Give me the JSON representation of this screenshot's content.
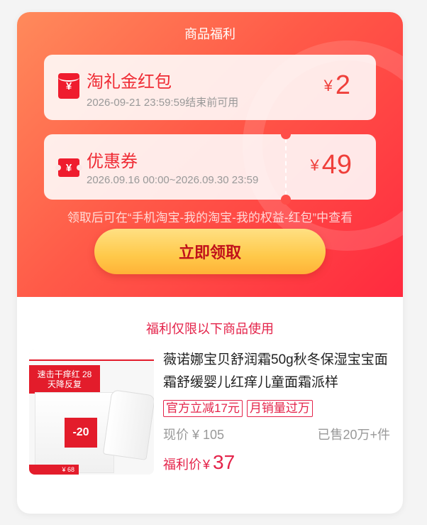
{
  "header": {
    "title": "商品福利"
  },
  "coupons": [
    {
      "name": "淘礼金红包",
      "validity": "2026-09-21 23:59:59结束前可用",
      "currency": "¥",
      "amount": "2",
      "icon": "red-envelope-icon"
    },
    {
      "name": "优惠券",
      "validity": "2026.09.16 00:00~2026.09.30 23:59",
      "currency": "¥",
      "amount": "49",
      "icon": "ticket-icon"
    }
  ],
  "hint": "领取后可在“手机淘宝-我的淘宝-我的权益-红包”中查看",
  "claim_button": "立即领取",
  "product_section": {
    "title": "福利仅限以下商品使用",
    "product": {
      "title": "薇诺娜宝贝舒润霜50g秋冬保湿宝宝面霜舒缓婴儿红痒儿童面霜派样",
      "tags": [
        "官方立减17元",
        "月销量过万"
      ],
      "current_price": "现价 ¥ 105",
      "sold": "已售20万+件",
      "deal_label": "福利价",
      "deal_currency": "¥",
      "deal_price": "37",
      "image_text": {
        "headline": "速击干痒红 28天降反复",
        "badge": "-20",
        "footer": "¥ 68"
      }
    }
  },
  "colors": {
    "accent": "#ef2b34",
    "price_red": "#e4234a",
    "button_gold": "#ffc94a"
  }
}
